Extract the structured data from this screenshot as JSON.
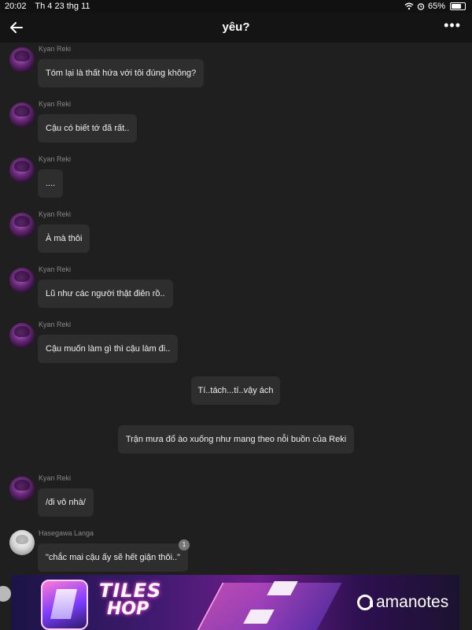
{
  "status_bar": {
    "time": "20:02",
    "date": "Th 4 23 thg 11",
    "battery": "65%",
    "battery_level": 0.65
  },
  "nav": {
    "title": "yêu?"
  },
  "messages": [
    {
      "sender": "Kyan Reki",
      "text": "Tóm lại là thất hứa với tôi đúng không?"
    },
    {
      "sender": "Kyan Reki",
      "text": "Cậu có biết tớ đã rất.."
    },
    {
      "sender": "Kyan Reki",
      "text": "...."
    },
    {
      "sender": "Kyan Reki",
      "text": "À mà thôi"
    },
    {
      "sender": "Kyan Reki",
      "text": "Lũ như các người thật điên rồ.."
    },
    {
      "sender": "Kyan Reki",
      "text": "Cậu muốn làm gì thì cậu làm đi.."
    },
    {
      "text": "Tí..tách...tí..vậy ách"
    },
    {
      "text": "Trận mưa đổ ào xuống như mang theo nỗi buồn của Reki"
    },
    {
      "sender": "Kyan Reki",
      "text": "/đi vô nhà/"
    },
    {
      "sender": "Hasegawa Langa",
      "text": "\"chắc mai cậu ấy sẽ hết giận thôi..\"",
      "badge": "1"
    }
  ],
  "ad": {
    "line1": "TILES",
    "line2": "HOP",
    "brand": "amanotes"
  },
  "colors": {
    "background": "#1f1f1f",
    "bubble": "#2e2e2e",
    "nav": "#141414",
    "ad_accent": "#ff47d1"
  }
}
